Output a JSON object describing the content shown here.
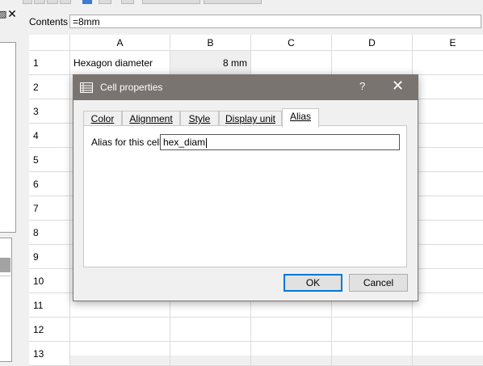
{
  "contents_bar": {
    "label": "Contents",
    "value": "=8mm"
  },
  "left_panel": {
    "pin_glyph": "▨",
    "close_glyph": "✕"
  },
  "grid": {
    "columns": [
      "A",
      "B",
      "C",
      "D",
      "E"
    ],
    "rows": [
      "1",
      "2",
      "3",
      "4",
      "5",
      "6",
      "7",
      "8",
      "9",
      "10",
      "11",
      "12",
      "13"
    ],
    "cells": {
      "A1": "Hexagon diameter",
      "B1": "8 mm"
    },
    "selected_cell": "B1"
  },
  "dialog": {
    "title": "Cell properties",
    "help_glyph": "?",
    "close_glyph": "✕",
    "tabs": [
      {
        "label": "Color",
        "active": false
      },
      {
        "label": "Alignment",
        "active": false
      },
      {
        "label": "Style",
        "active": false
      },
      {
        "label": "Display unit",
        "active": false
      },
      {
        "label": "Alias",
        "active": true
      }
    ],
    "alias_label": "Alias for this cell",
    "alias_value": "hex_diam",
    "ok_label": "OK",
    "cancel_label": "Cancel"
  },
  "colors": {
    "dialog_title_bar": "#7a7471",
    "default_button_border": "#0078d7"
  }
}
